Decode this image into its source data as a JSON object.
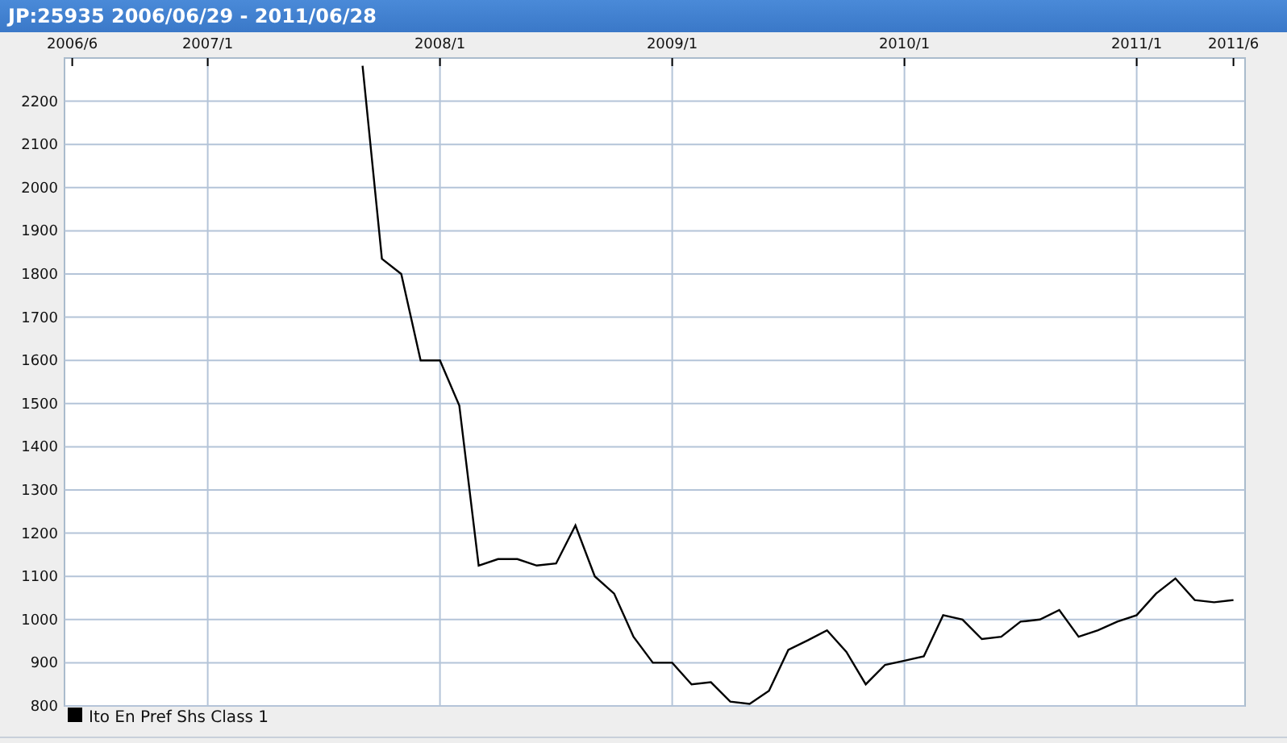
{
  "window": {
    "title": "JP:25935 2006/06/29 - 2011/06/28"
  },
  "chart": {
    "chart_data": {
      "type": "line",
      "categories": [
        "2006/6",
        null,
        null,
        null,
        null,
        null,
        null,
        "2007/1",
        null,
        null,
        null,
        null,
        null,
        null,
        null,
        null,
        null,
        null,
        null,
        "2008/1",
        null,
        null,
        null,
        null,
        null,
        null,
        null,
        null,
        null,
        null,
        null,
        "2009/1",
        null,
        null,
        null,
        null,
        null,
        null,
        null,
        null,
        null,
        null,
        null,
        "2010/1",
        null,
        null,
        null,
        null,
        null,
        null,
        null,
        null,
        null,
        null,
        null,
        "2011/1",
        null,
        null,
        null,
        null,
        "2011/6"
      ],
      "series": [
        {
          "name": "Ito En Pref Shs Class 1",
          "color": "#000000",
          "values": [
            null,
            null,
            null,
            null,
            null,
            null,
            null,
            null,
            null,
            null,
            null,
            null,
            null,
            null,
            null,
            2282,
            1835,
            1800,
            1600,
            1600,
            1495,
            1125,
            1140,
            1140,
            1125,
            1130,
            1218,
            1100,
            1060,
            960,
            900,
            900,
            850,
            855,
            810,
            805,
            835,
            930,
            952,
            975,
            925,
            850,
            895,
            905,
            915,
            1010,
            1000,
            955,
            960,
            995,
            1000,
            1022,
            960,
            975,
            995,
            1010,
            1060,
            1095,
            1045,
            1040,
            1045
          ]
        }
      ],
      "grid": true,
      "ylim": [
        800,
        2300
      ],
      "yticks": [
        800,
        900,
        1000,
        1100,
        1200,
        1300,
        1400,
        1500,
        1600,
        1700,
        1800,
        1900,
        2000,
        2100,
        2200
      ]
    }
  }
}
